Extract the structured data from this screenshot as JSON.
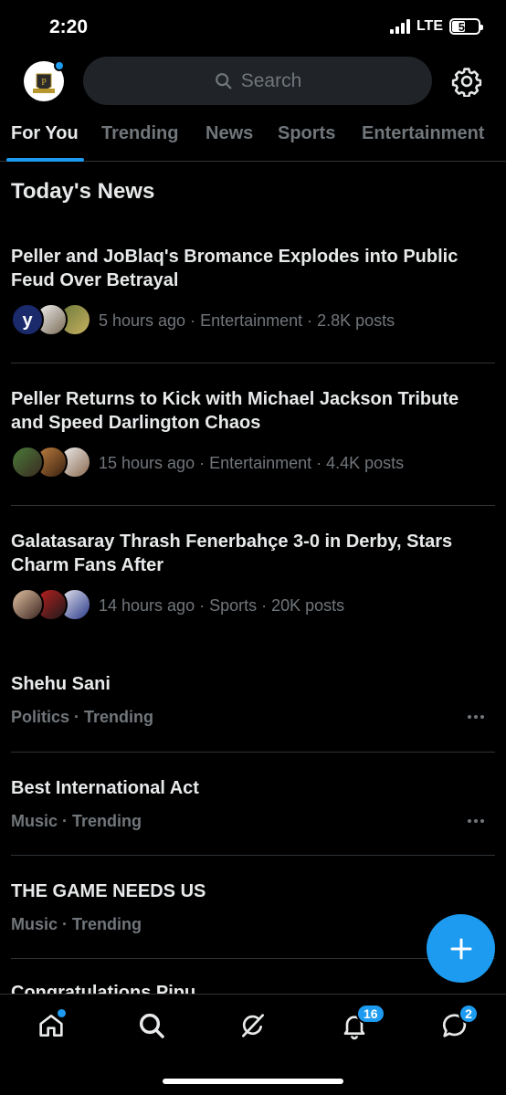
{
  "status_bar": {
    "time": "2:20",
    "network": "LTE",
    "battery": "50",
    "battery_level": 0.5
  },
  "header": {
    "avatar_text": "PELLERIAN",
    "search_placeholder": "Search"
  },
  "tabs": [
    {
      "label": "For You",
      "active": true
    },
    {
      "label": "Trending",
      "active": false
    },
    {
      "label": "News",
      "active": false
    },
    {
      "label": "Sports",
      "active": false
    },
    {
      "label": "Entertainment",
      "active": false
    }
  ],
  "section_title": "Today's News",
  "news": [
    {
      "headline": "Peller and JoBlaq's Bromance Explodes into Public Feud Over Betrayal",
      "meta": "5 hours ago · Entertainment · 2.8K posts"
    },
    {
      "headline": "Peller Returns to Kick with Michael Jackson Tribute and Speed Darlington Chaos",
      "meta": "15 hours ago · Entertainment · 4.4K posts"
    },
    {
      "headline": "Galatasaray Thrash Fenerbahçe 3-0 in Derby, Stars Charm Fans After",
      "meta": "14 hours ago · Sports · 20K posts"
    }
  ],
  "trends": [
    {
      "title": "Shehu Sani",
      "meta": "Politics · Trending"
    },
    {
      "title": "Best International Act",
      "meta": "Music · Trending"
    },
    {
      "title": "THE GAME NEEDS US",
      "meta": "Music · Trending"
    }
  ],
  "partial_trend": "Congratulations Pipu",
  "bottom_nav": {
    "notifications_badge": "16",
    "messages_badge": "2"
  },
  "colors": {
    "accent": "#1d9bf0",
    "background": "#000000",
    "muted": "#71767b",
    "text": "#e7e9ea"
  }
}
